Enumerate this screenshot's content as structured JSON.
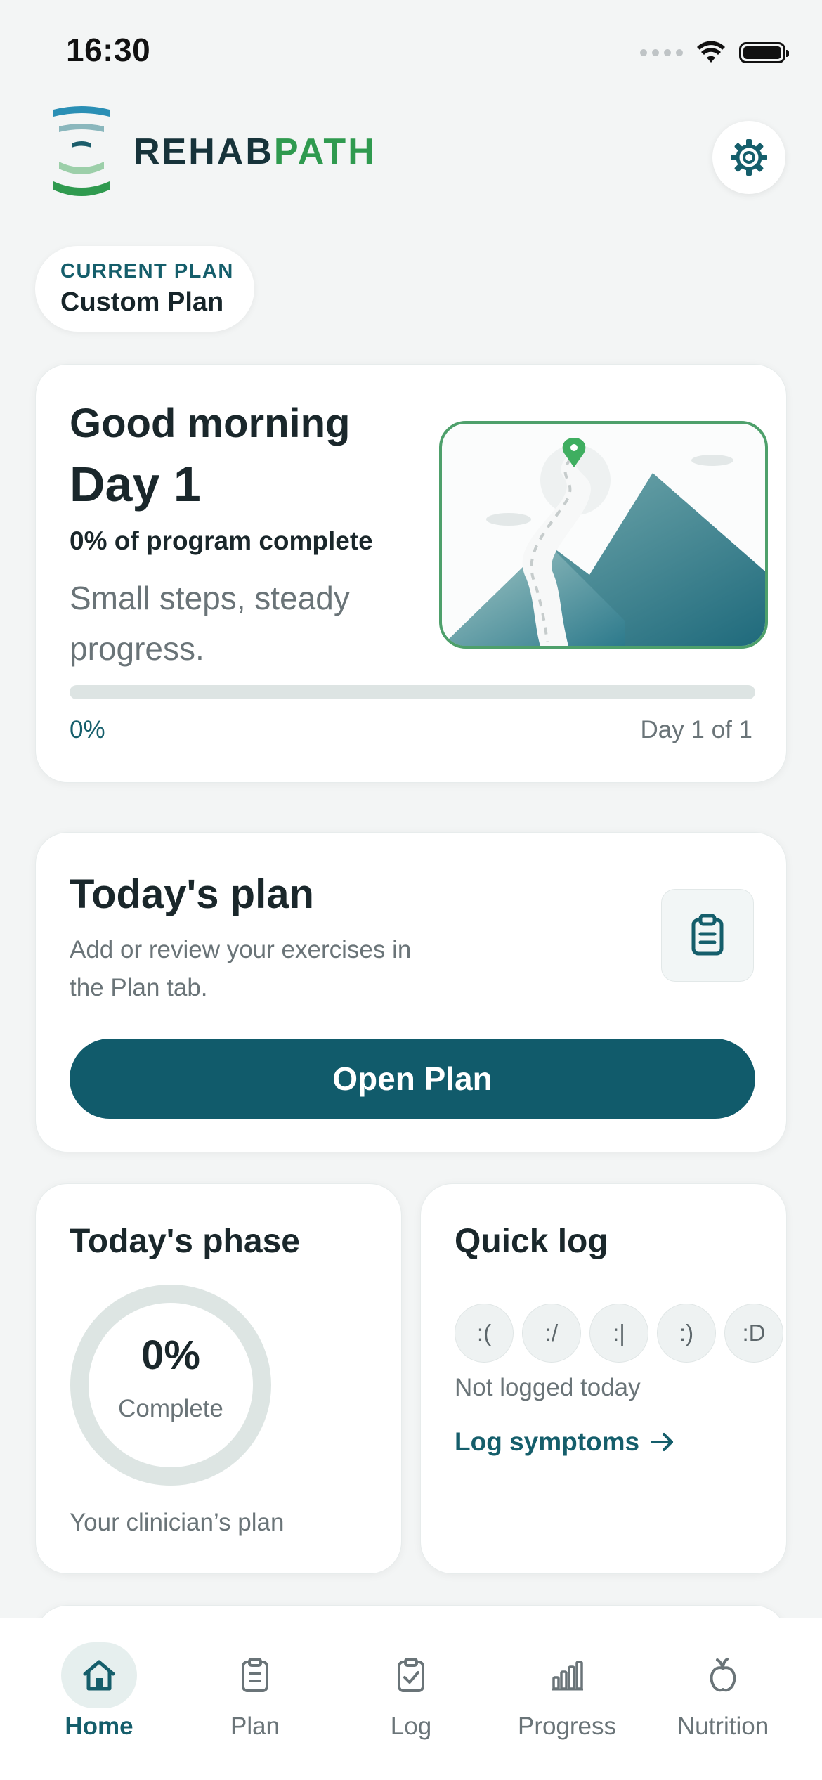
{
  "status_bar": {
    "time": "16:30"
  },
  "brand": {
    "name_part1": "REHAB",
    "name_part2": "PATH"
  },
  "header": {
    "settings_icon": "gear-icon"
  },
  "current_plan": {
    "label": "CURRENT PLAN",
    "value": "Custom Plan"
  },
  "hero": {
    "greeting": "Good morning",
    "day": "Day 1",
    "percent_text": "0% of program complete",
    "motto": "Small steps, steady progress.",
    "progress": 0,
    "progress_label": "0%",
    "day_of": "Day 1 of 1"
  },
  "today_plan": {
    "title": "Today's plan",
    "description": "Add or review your exercises in the Plan tab.",
    "button_label": "Open Plan",
    "icon": "clipboard-icon"
  },
  "phase": {
    "title": "Today's phase",
    "percent": "0%",
    "progress": 0,
    "complete_label": "Complete",
    "footer": "Your clinician’s plan"
  },
  "quick_log": {
    "title": "Quick log",
    "moods": [
      ":(",
      ":/",
      ":|",
      ":)",
      ":D"
    ],
    "status": "Not logged today",
    "link_label": "Log symptoms"
  },
  "tabs": [
    {
      "label": "Home",
      "icon": "home-icon",
      "active": true
    },
    {
      "label": "Plan",
      "icon": "clipboard-icon",
      "active": false
    },
    {
      "label": "Log",
      "icon": "checklist-icon",
      "active": false
    },
    {
      "label": "Progress",
      "icon": "bar-chart-icon",
      "active": false
    },
    {
      "label": "Nutrition",
      "icon": "fruit-icon",
      "active": false
    }
  ],
  "colors": {
    "primary": "#115b6b",
    "accent": "#2f9a4f",
    "background": "#f3f5f5"
  }
}
